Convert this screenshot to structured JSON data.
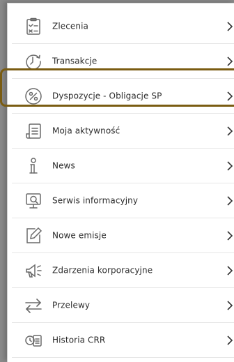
{
  "menu": {
    "items": [
      {
        "label": "Zlecenia",
        "icon": "orders-checklist-icon"
      },
      {
        "label": "Transakcje",
        "icon": "transactions-history-icon"
      },
      {
        "label": "Dyspozycje - Obligacje SP",
        "icon": "percent-circle-icon"
      },
      {
        "label": "Moja aktywność",
        "icon": "activity-document-icon"
      },
      {
        "label": "News",
        "icon": "info-icon"
      },
      {
        "label": "Serwis informacyjny",
        "icon": "info-monitor-icon"
      },
      {
        "label": "Nowe emisje",
        "icon": "edit-document-icon"
      },
      {
        "label": "Zdarzenia korporacyjne",
        "icon": "megaphone-icon"
      },
      {
        "label": "Przelewy",
        "icon": "transfer-arrows-icon"
      },
      {
        "label": "Historia CRR",
        "icon": "crr-history-icon"
      }
    ]
  },
  "colors": {
    "highlight_border": "#7a5c12",
    "icon_stroke": "#6a6a6a",
    "text": "#2b2b2b"
  }
}
